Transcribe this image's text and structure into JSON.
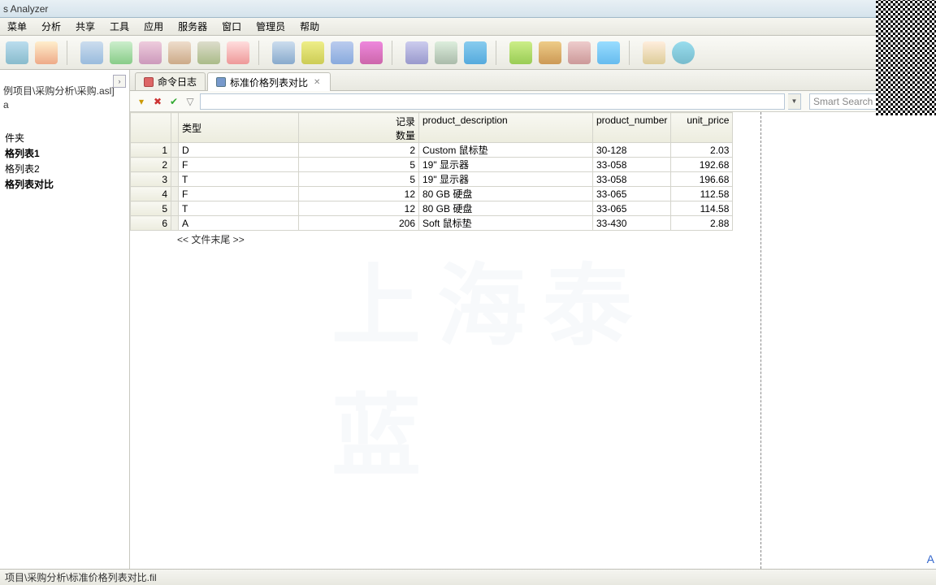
{
  "title": "s Analyzer",
  "menus": [
    "菜单",
    "分析",
    "共享",
    "工具",
    "应用",
    "服务器",
    "窗口",
    "管理员",
    "帮助"
  ],
  "sidebar": {
    "path": "例项目\\采购分析\\采购.asl]",
    "sub": "a",
    "folder": "件夹",
    "items": [
      "格列表1",
      "格列表2",
      "格列表对比"
    ]
  },
  "tabs": [
    {
      "label": "命令日志",
      "active": false
    },
    {
      "label": "标准价格列表对比",
      "active": true,
      "closable": true
    }
  ],
  "smart_search": "Smart Search",
  "columns": {
    "type": "类型",
    "records": "记录\n数量",
    "desc": "product_description",
    "num": "product_number",
    "price": "unit_price"
  },
  "rows": [
    {
      "n": 1,
      "type": "D",
      "rec": 2,
      "desc": "Custom 鼠标垫",
      "num": "30-128",
      "price": "2.03"
    },
    {
      "n": 2,
      "type": "F",
      "rec": 5,
      "desc": "19\" 显示器",
      "num": "33-058",
      "price": "192.68"
    },
    {
      "n": 3,
      "type": "T",
      "rec": 5,
      "desc": "19\" 显示器",
      "num": "33-058",
      "price": "196.68"
    },
    {
      "n": 4,
      "type": "F",
      "rec": 12,
      "desc": "80 GB 硬盘",
      "num": "33-065",
      "price": "112.58"
    },
    {
      "n": 5,
      "type": "T",
      "rec": 12,
      "desc": "80 GB 硬盘",
      "num": "33-065",
      "price": "114.58"
    },
    {
      "n": 6,
      "type": "A",
      "rec": 206,
      "desc": "Soft 鼠标垫",
      "num": "33-430",
      "price": "2.88"
    }
  ],
  "eof": "<< 文件末尾 >>",
  "status": "项目\\采购分析\\标准价格列表对比.fil",
  "watermark": "上海泰蓝",
  "right_marker": "A"
}
